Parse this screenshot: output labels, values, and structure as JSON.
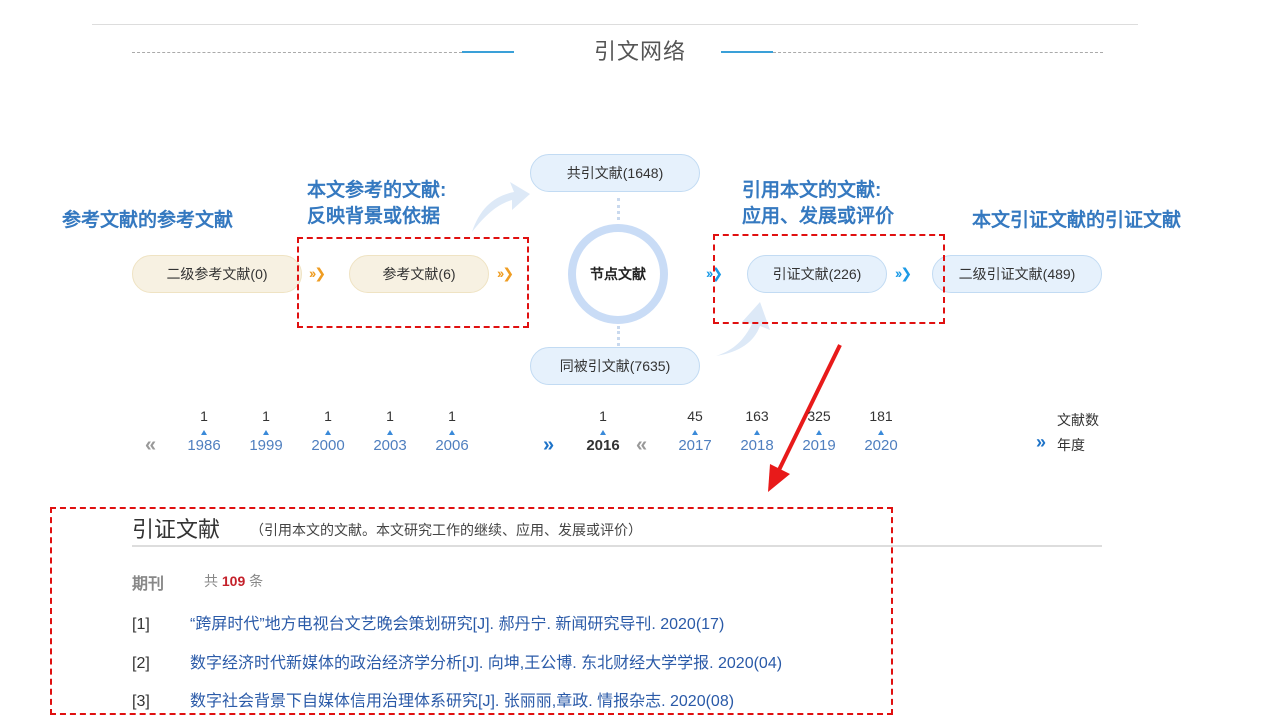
{
  "section_title": "引文网络",
  "annotations": {
    "secondary_refs": "参考文献的参考文献",
    "refs": [
      "本文参考的文献:",
      "反映背景或依据"
    ],
    "citing": [
      "引用本文的文献:",
      "应用、发展或评价"
    ],
    "secondary_citing": "本文引证文献的引证文献"
  },
  "network": {
    "co_citation": "共引文献(1648)",
    "secondary_reference": "二级参考文献(0)",
    "reference": "参考文献(6)",
    "node": "节点文献",
    "citing": "引证文献(226)",
    "secondary_citing": "二级引证文献(489)",
    "co_cited": "同被引文献(7635)",
    "colors": {
      "tan_pill": "#f7f1e2",
      "blue_pill": "#e6f1fc",
      "red_dash": "#e01010",
      "accent_blue": "#3579c0"
    }
  },
  "timeline": {
    "left": [
      {
        "count": "1",
        "year": "1986"
      },
      {
        "count": "1",
        "year": "1999"
      },
      {
        "count": "1",
        "year": "2000"
      },
      {
        "count": "1",
        "year": "2003"
      },
      {
        "count": "1",
        "year": "2006"
      }
    ],
    "center": {
      "count": "1",
      "year": "2016"
    },
    "right": [
      {
        "count": "45",
        "year": "2017"
      },
      {
        "count": "163",
        "year": "2018"
      },
      {
        "count": "325",
        "year": "2019"
      },
      {
        "count": "181",
        "year": "2020"
      }
    ],
    "legend_count": "文献数",
    "legend_year": "年度",
    "prev_icon": "«",
    "next_icon": "»"
  },
  "citing_section": {
    "title": "引证文献",
    "description": "（引用本文的文献。本文研究工作的继续、应用、发展或评价）",
    "category": "期刊",
    "count_prefix": "共",
    "count": "109",
    "count_suffix": "条",
    "items": [
      {
        "index": "[1]",
        "text": "“跨屏时代”地方电视台文艺晚会策划研究[J]. 郝丹宁.  新闻研究导刊. 2020(17)"
      },
      {
        "index": "[2]",
        "text": "数字经济时代新媒体的政治经济学分析[J]. 向坤,王公博.  东北财经大学学报. 2020(04)"
      },
      {
        "index": "[3]",
        "text": "数字社会背景下自媒体信用治理体系研究[J]. 张丽丽,章政.  情报杂志. 2020(08)"
      }
    ]
  }
}
